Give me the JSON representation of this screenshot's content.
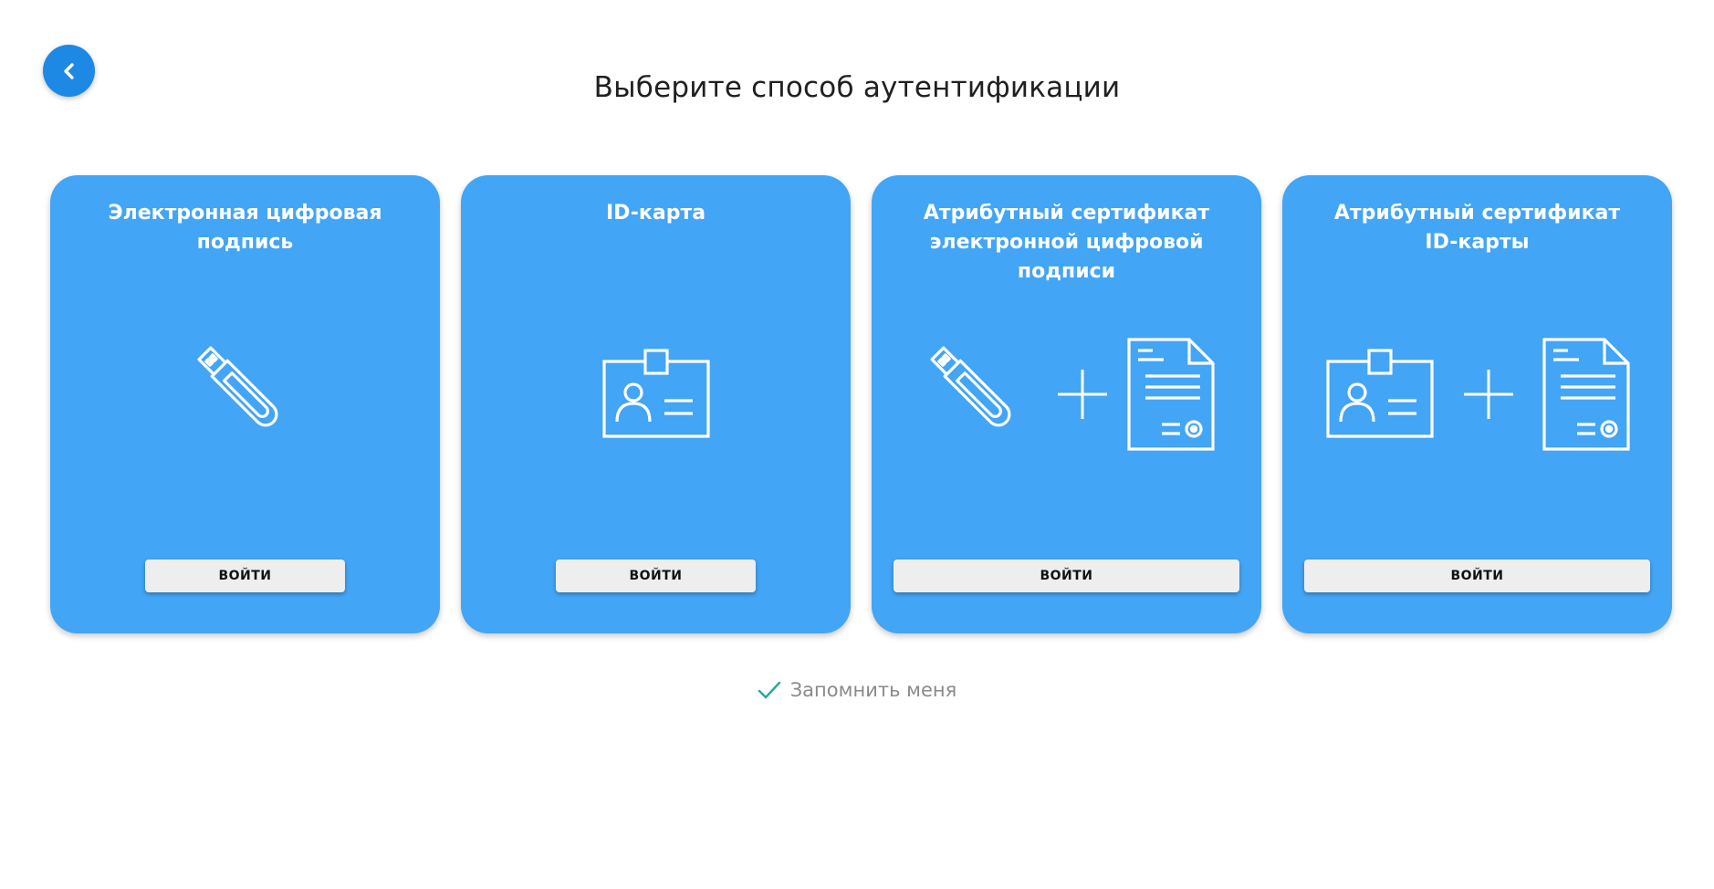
{
  "header": {
    "back_icon": "chevron-left-icon",
    "title": "Выберите способ аутентификации"
  },
  "colors": {
    "accent": "#1e88e5",
    "card_background": "#42a5f5",
    "check": "#26a69a"
  },
  "cards": [
    {
      "title": "Электронная цифровая подпись",
      "icons": [
        "usb-token-icon"
      ],
      "button_label": "ВОЙТИ"
    },
    {
      "title": "ID-карта",
      "icons": [
        "id-card-icon"
      ],
      "button_label": "ВОЙТИ"
    },
    {
      "title": "Атрибутный сертификат электронной цифровой подписи",
      "icons": [
        "usb-token-icon",
        "plus-icon",
        "certificate-icon"
      ],
      "button_label": "ВОЙТИ"
    },
    {
      "title": "Атрибутный сертификат ID-карты",
      "icons": [
        "id-card-icon",
        "plus-icon",
        "certificate-icon"
      ],
      "button_label": "ВОЙТИ"
    }
  ],
  "remember": {
    "label": "Запомнить меня",
    "checked": true
  }
}
